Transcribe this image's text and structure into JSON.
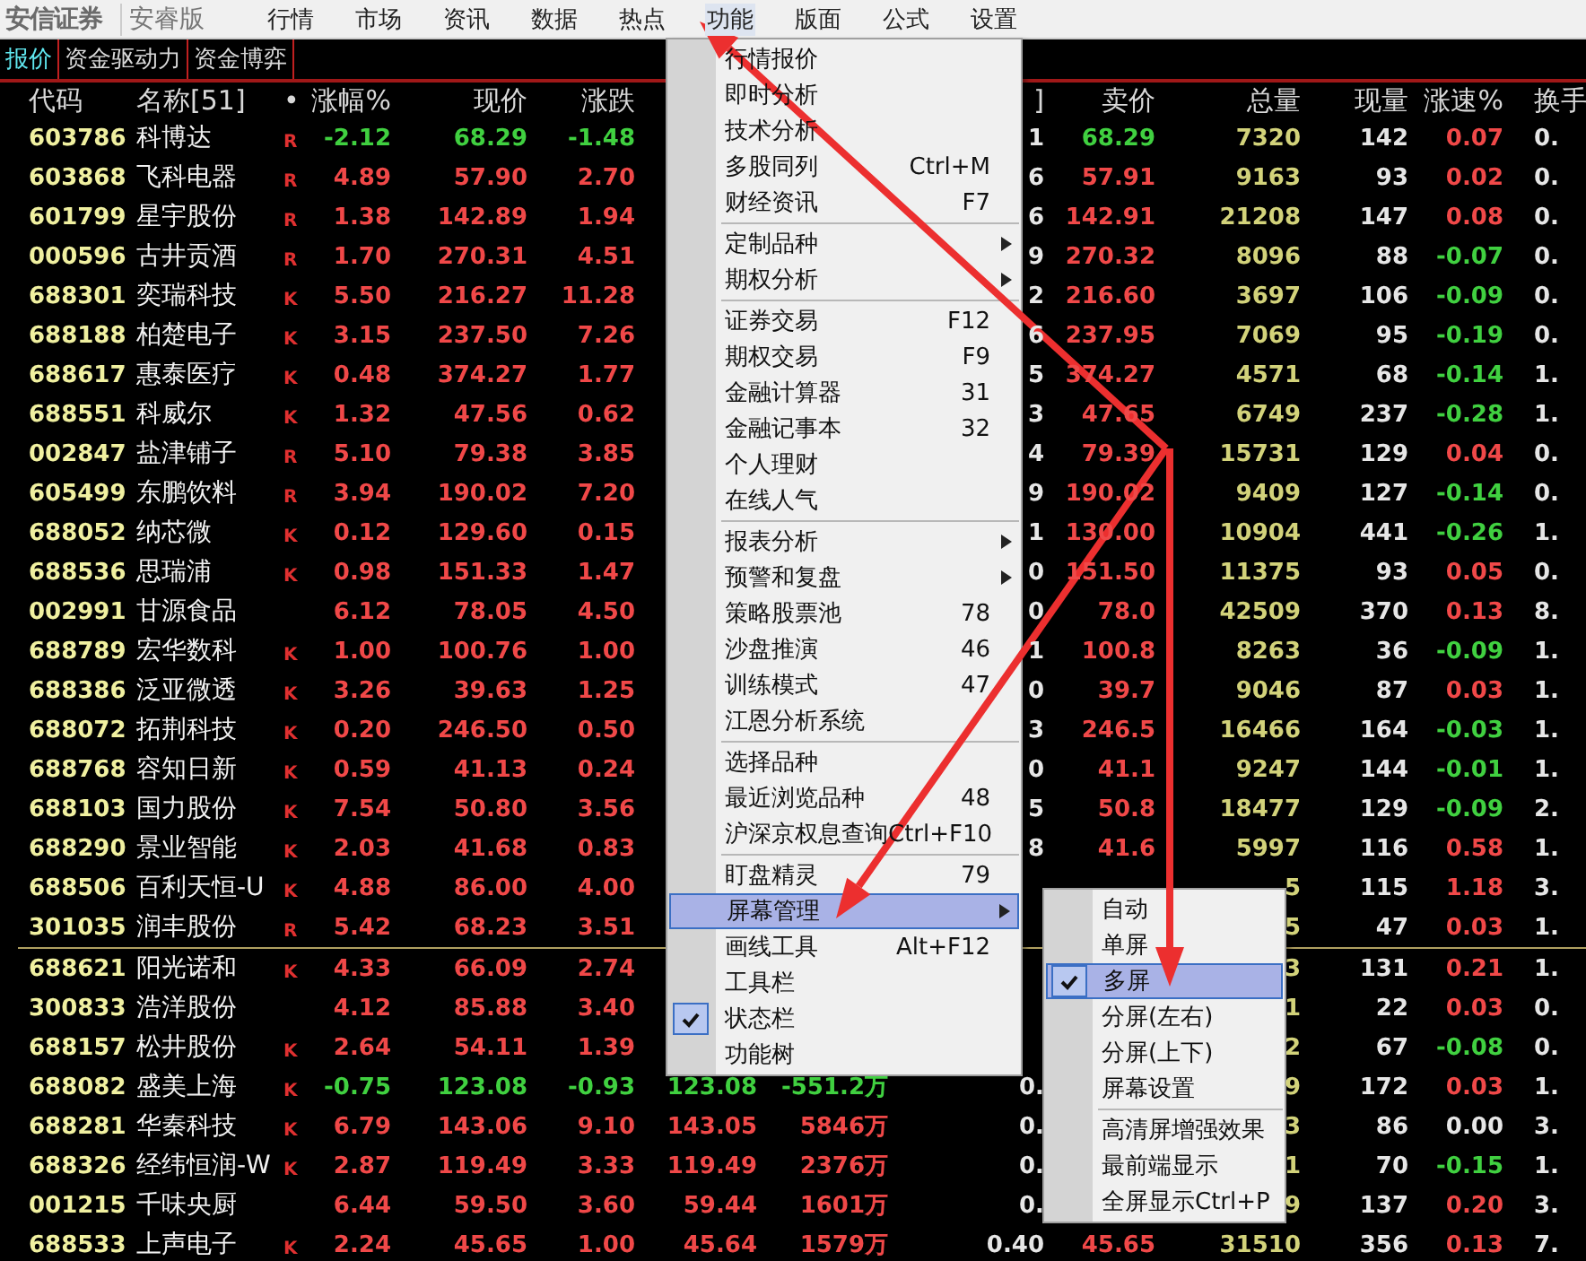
{
  "app": {
    "logo": "安信证券",
    "edition": "安睿版"
  },
  "menubar": [
    {
      "label": "行情",
      "selected": false
    },
    {
      "label": "市场",
      "selected": false
    },
    {
      "label": "资讯",
      "selected": false
    },
    {
      "label": "数据",
      "selected": false
    },
    {
      "label": "热点",
      "selected": false
    },
    {
      "label": "功能",
      "selected": true
    },
    {
      "label": "版面",
      "selected": false
    },
    {
      "label": "公式",
      "selected": false
    },
    {
      "label": "设置",
      "selected": false
    }
  ],
  "tabs": [
    {
      "label": "报价",
      "selected": true
    },
    {
      "label": "资金驱动力",
      "selected": false
    },
    {
      "label": "资金博弈",
      "selected": false
    }
  ],
  "table": {
    "columns": {
      "code": "代码",
      "name": "名称[51]",
      "mark": "•",
      "chg": "涨幅%",
      "price": "现价",
      "diff": "涨跌",
      "ratio": "]",
      "ask": "卖价",
      "vol": "总量",
      "cur": "现量",
      "speed": "涨速%",
      "turn": "换手"
    },
    "groups": [
      {
        "rows": [
          {
            "code": "603786",
            "name": "科博达",
            "mark": "R",
            "chg": "-2.12",
            "price": "68.29",
            "diff": "-1.48",
            "ratio": "1",
            "ask": "68.29",
            "vol": "7320",
            "cur": "142",
            "speed": "0.07",
            "turn": "0.",
            "falling": true,
            "speed_rising": true,
            "speed_falling": false
          },
          {
            "code": "603868",
            "name": "飞科电器",
            "mark": "R",
            "chg": "4.89",
            "price": "57.90",
            "diff": "2.70",
            "ratio": "6",
            "ask": "57.91",
            "vol": "9163",
            "cur": "93",
            "speed": "0.02",
            "turn": "0.",
            "falling": false,
            "speed_rising": true,
            "speed_falling": false
          },
          {
            "code": "601799",
            "name": "星宇股份",
            "mark": "R",
            "chg": "1.38",
            "price": "142.89",
            "diff": "1.94",
            "ratio": "6",
            "ask": "142.91",
            "vol": "21208",
            "cur": "147",
            "speed": "0.08",
            "turn": "0.",
            "falling": false,
            "speed_rising": true,
            "speed_falling": false
          },
          {
            "code": "000596",
            "name": "古井贡酒",
            "mark": "R",
            "chg": "1.70",
            "price": "270.31",
            "diff": "4.51",
            "ratio": "9",
            "ask": "270.32",
            "vol": "8096",
            "cur": "88",
            "speed": "-0.07",
            "turn": "0.",
            "falling": false,
            "speed_rising": false,
            "speed_falling": true
          },
          {
            "code": "688301",
            "name": "奕瑞科技",
            "mark": "K",
            "chg": "5.50",
            "price": "216.27",
            "diff": "11.28",
            "ratio": "2",
            "ask": "216.60",
            "vol": "3697",
            "cur": "106",
            "speed": "-0.09",
            "turn": "0.",
            "falling": false,
            "speed_rising": false,
            "speed_falling": true
          },
          {
            "code": "688188",
            "name": "柏楚电子",
            "mark": "K",
            "chg": "3.15",
            "price": "237.50",
            "diff": "7.26",
            "ratio": "6",
            "ask": "237.95",
            "vol": "7069",
            "cur": "95",
            "speed": "-0.19",
            "turn": "0.",
            "falling": false,
            "speed_rising": false,
            "speed_falling": true
          },
          {
            "code": "688617",
            "name": "惠泰医疗",
            "mark": "K",
            "chg": "0.48",
            "price": "374.27",
            "diff": "1.77",
            "ratio": "5",
            "ask": "374.27",
            "vol": "4571",
            "cur": "68",
            "speed": "-0.14",
            "turn": "1.",
            "falling": false,
            "speed_rising": false,
            "speed_falling": true
          },
          {
            "code": "688551",
            "name": "科威尔",
            "mark": "K",
            "chg": "1.32",
            "price": "47.56",
            "diff": "0.62",
            "ratio": "3",
            "ask": "47.65",
            "vol": "6749",
            "cur": "237",
            "speed": "-0.28",
            "turn": "1.",
            "falling": false,
            "speed_rising": false,
            "speed_falling": true
          },
          {
            "code": "002847",
            "name": "盐津铺子",
            "mark": "R",
            "chg": "5.10",
            "price": "79.38",
            "diff": "3.85",
            "ratio": "4",
            "ask": "79.39",
            "vol": "15731",
            "cur": "129",
            "speed": "0.04",
            "turn": "0.",
            "falling": false,
            "speed_rising": true,
            "speed_falling": false
          },
          {
            "code": "605499",
            "name": "东鹏饮料",
            "mark": "R",
            "chg": "3.94",
            "price": "190.02",
            "diff": "7.20",
            "ratio": "9",
            "ask": "190.02",
            "vol": "9409",
            "cur": "127",
            "speed": "-0.14",
            "turn": "0.",
            "falling": false,
            "speed_rising": false,
            "speed_falling": true
          },
          {
            "code": "688052",
            "name": "纳芯微",
            "mark": "K",
            "chg": "0.12",
            "price": "129.60",
            "diff": "0.15",
            "ratio": "1",
            "ask": "130.00",
            "vol": "10904",
            "cur": "441",
            "speed": "-0.26",
            "turn": "1.",
            "falling": false,
            "speed_rising": false,
            "speed_falling": true
          },
          {
            "code": "688536",
            "name": "思瑞浦",
            "mark": "K",
            "chg": "0.98",
            "price": "151.33",
            "diff": "1.47",
            "ratio": "0",
            "ask": "151.50",
            "vol": "11375",
            "cur": "93",
            "speed": "0.05",
            "turn": "0.",
            "falling": false,
            "speed_rising": true,
            "speed_falling": false
          },
          {
            "code": "002991",
            "name": "甘源食品",
            "chg": "6.12",
            "price": "78.05",
            "diff": "4.50",
            "ratio": "0",
            "ask": "78.0",
            "vol": "42509",
            "cur": "370",
            "speed": "0.13",
            "turn": "8.",
            "falling": false,
            "speed_rising": true,
            "speed_falling": false
          },
          {
            "code": "688789",
            "name": "宏华数科",
            "mark": "K",
            "chg": "1.00",
            "price": "100.76",
            "diff": "1.00",
            "ratio": "1",
            "ask": "100.8",
            "vol": "8263",
            "cur": "36",
            "speed": "-0.09",
            "turn": "1.",
            "falling": false,
            "speed_rising": false,
            "speed_falling": true
          },
          {
            "code": "688386",
            "name": "泛亚微透",
            "mark": "K",
            "chg": "3.26",
            "price": "39.63",
            "diff": "1.25",
            "ratio": "0",
            "ask": "39.7",
            "vol": "9046",
            "cur": "87",
            "speed": "0.03",
            "turn": "1.",
            "falling": false,
            "speed_rising": true,
            "speed_falling": false
          },
          {
            "code": "688072",
            "name": "拓荆科技",
            "mark": "K",
            "chg": "0.20",
            "price": "246.50",
            "diff": "0.50",
            "ratio": "3",
            "ask": "246.5",
            "vol": "16466",
            "cur": "164",
            "speed": "-0.03",
            "turn": "1.",
            "falling": false,
            "speed_rising": false,
            "speed_falling": true
          },
          {
            "code": "688768",
            "name": "容知日新",
            "mark": "K",
            "chg": "0.59",
            "price": "41.13",
            "diff": "0.24",
            "ratio": "0",
            "ask": "41.1",
            "vol": "9247",
            "cur": "144",
            "speed": "-0.01",
            "turn": "1.",
            "falling": false,
            "speed_rising": false,
            "speed_falling": true
          },
          {
            "code": "688103",
            "name": "国力股份",
            "mark": "K",
            "chg": "7.54",
            "price": "50.80",
            "diff": "3.56",
            "ratio": "5",
            "ask": "50.8",
            "vol": "18477",
            "cur": "129",
            "speed": "-0.09",
            "turn": "2.",
            "falling": false,
            "speed_rising": false,
            "speed_falling": true
          },
          {
            "code": "688290",
            "name": "景业智能",
            "mark": "K",
            "chg": "2.03",
            "price": "41.68",
            "diff": "0.83",
            "ratio": "8",
            "ask": "41.6",
            "vol": "5997",
            "cur": "116",
            "speed": "0.58",
            "turn": "1.",
            "falling": false,
            "speed_rising": true,
            "speed_falling": false
          },
          {
            "code": "688506",
            "name": "百利天恒-U",
            "mark": "K",
            "chg": "4.88",
            "price": "86.00",
            "diff": "4.00",
            "vol": "5",
            "cur": "115",
            "speed": "1.18",
            "turn": "3.",
            "falling": false,
            "speed_rising": true,
            "speed_falling": false
          },
          {
            "code": "301035",
            "name": "润丰股份",
            "mark": "R",
            "chg": "5.42",
            "price": "68.23",
            "diff": "3.51",
            "vol": "5",
            "cur": "47",
            "speed": "0.03",
            "turn": "1.",
            "falling": false,
            "speed_rising": true,
            "speed_falling": false
          }
        ]
      },
      {
        "rows": [
          {
            "code": "688621",
            "name": "阳光诺和",
            "mark": "K",
            "chg": "4.33",
            "price": "66.09",
            "diff": "2.74",
            "vol": "3",
            "cur": "131",
            "speed": "0.21",
            "turn": "1.",
            "falling": false,
            "speed_rising": true,
            "speed_falling": false
          },
          {
            "code": "300833",
            "name": "浩洋股份",
            "chg": "4.12",
            "price": "85.88",
            "diff": "3.40",
            "vol": "1",
            "cur": "22",
            "speed": "0.03",
            "turn": "0.",
            "falling": false,
            "speed_rising": true,
            "speed_falling": false
          },
          {
            "code": "688157",
            "name": "松井股份",
            "mark": "K",
            "chg": "2.64",
            "price": "54.11",
            "diff": "1.39",
            "vol": "2",
            "cur": "67",
            "speed": "-0.08",
            "turn": "0.",
            "falling": false,
            "speed_rising": false,
            "speed_falling": true
          },
          {
            "code": "688082",
            "name": "盛美上海",
            "mark": "K",
            "chg": "-0.75",
            "price": "123.08",
            "diff": "-0.93",
            "bid": "123.08",
            "amount": "-551.2万",
            "ratio": "0.",
            "vol": "9",
            "cur": "172",
            "speed": "0.03",
            "turn": "1.",
            "falling": true,
            "speed_rising": true,
            "speed_falling": false
          },
          {
            "code": "688281",
            "name": "华秦科技",
            "mark": "K",
            "chg": "6.79",
            "price": "143.06",
            "diff": "9.10",
            "bid": "143.05",
            "amount": "5846万",
            "ratio": "0.",
            "vol": "3",
            "cur": "86",
            "speed": "0.00",
            "turn": "3.",
            "falling": false,
            "speed_rising": false,
            "speed_falling": false
          },
          {
            "code": "688326",
            "name": "经纬恒润-W",
            "mark": "K",
            "chg": "2.87",
            "price": "119.49",
            "diff": "3.33",
            "bid": "119.49",
            "amount": "2376万",
            "ratio": "0.",
            "vol": "1",
            "cur": "70",
            "speed": "-0.15",
            "turn": "1.",
            "falling": false,
            "speed_rising": false,
            "speed_falling": true
          },
          {
            "code": "001215",
            "name": "千味央厨",
            "chg": "6.44",
            "price": "59.50",
            "diff": "3.60",
            "bid": "59.44",
            "amount": "1601万",
            "ratio": "0.",
            "vol": "9",
            "cur": "137",
            "speed": "0.20",
            "turn": "3.",
            "falling": false,
            "speed_rising": true,
            "speed_falling": false
          },
          {
            "code": "688533",
            "name": "上声电子",
            "mark": "K",
            "chg": "2.24",
            "price": "45.65",
            "diff": "1.00",
            "bid": "45.64",
            "amount": "1579万",
            "ratio": "0.40",
            "ask": "45.65",
            "vol": "31510",
            "cur": "356",
            "speed": "0.13",
            "turn": "7.",
            "falling": false,
            "speed_rising": true,
            "speed_falling": false
          }
        ]
      }
    ]
  },
  "menu": {
    "groups": [
      [
        {
          "label": "行情报价",
          "selected": false,
          "checked": false
        },
        {
          "label": "即时分析",
          "selected": false,
          "checked": false
        },
        {
          "label": "技术分析",
          "selected": false,
          "checked": false
        },
        {
          "label": "多股同列",
          "shortcut": "Ctrl+M",
          "selected": false,
          "checked": false
        },
        {
          "label": "财经资讯",
          "shortcut": "F7",
          "selected": false,
          "checked": false
        }
      ],
      [
        {
          "label": "定制品种",
          "submenu": true,
          "selected": false,
          "checked": false
        },
        {
          "label": "期权分析",
          "submenu": true,
          "selected": false,
          "checked": false
        }
      ],
      [
        {
          "label": "证券交易",
          "shortcut": "F12",
          "selected": false,
          "checked": false
        },
        {
          "label": "期权交易",
          "shortcut": "F9",
          "selected": false,
          "checked": false
        },
        {
          "label": "金融计算器",
          "shortcut": "31",
          "selected": false,
          "checked": false
        },
        {
          "label": "金融记事本",
          "shortcut": "32",
          "selected": false,
          "checked": false
        },
        {
          "label": "个人理财",
          "selected": false,
          "checked": false
        },
        {
          "label": "在线人气",
          "selected": false,
          "checked": false
        }
      ],
      [
        {
          "label": "报表分析",
          "submenu": true,
          "selected": false,
          "checked": false
        },
        {
          "label": "预警和复盘",
          "submenu": true,
          "selected": false,
          "checked": false
        },
        {
          "label": "策略股票池",
          "shortcut": "78",
          "selected": false,
          "checked": false
        },
        {
          "label": "沙盘推演",
          "shortcut": "46",
          "selected": false,
          "checked": false
        },
        {
          "label": "训练模式",
          "shortcut": "47",
          "selected": false,
          "checked": false
        },
        {
          "label": "江恩分析系统",
          "selected": false,
          "checked": false
        }
      ],
      [
        {
          "label": "选择品种",
          "selected": false,
          "checked": false
        },
        {
          "label": "最近浏览品种",
          "shortcut": "48",
          "selected": false,
          "checked": false
        },
        {
          "label": "沪深京权息查询",
          "shortcut": "Ctrl+F10",
          "selected": false,
          "checked": false
        }
      ],
      [
        {
          "label": "盯盘精灵",
          "shortcut": "79",
          "selected": false,
          "checked": false
        },
        {
          "label": "屏幕管理",
          "submenu": true,
          "selected": true,
          "checked": false
        },
        {
          "label": "画线工具",
          "shortcut": "Alt+F12",
          "selected": false,
          "checked": false
        },
        {
          "label": "工具栏",
          "selected": false,
          "checked": false
        },
        {
          "label": "状态栏",
          "selected": false,
          "checked": true
        },
        {
          "label": "功能树",
          "selected": false,
          "checked": false
        }
      ]
    ]
  },
  "submenu": {
    "groups": [
      [
        {
          "label": "自动",
          "selected": false,
          "checked": false
        },
        {
          "label": "单屏",
          "selected": false,
          "checked": false
        },
        {
          "label": "多屏",
          "selected": true,
          "checked": true
        },
        {
          "label": "分屏(左右)",
          "selected": false,
          "checked": false
        },
        {
          "label": "分屏(上下)",
          "selected": false,
          "checked": false
        },
        {
          "label": "屏幕设置",
          "selected": false,
          "checked": false
        }
      ],
      [
        {
          "label": "高清屏增强效果",
          "selected": false,
          "checked": false
        },
        {
          "label": "最前端显示",
          "selected": false,
          "checked": false
        },
        {
          "label": "全屏显示",
          "shortcut": "Ctrl+P",
          "selected": false,
          "checked": false
        }
      ]
    ]
  }
}
